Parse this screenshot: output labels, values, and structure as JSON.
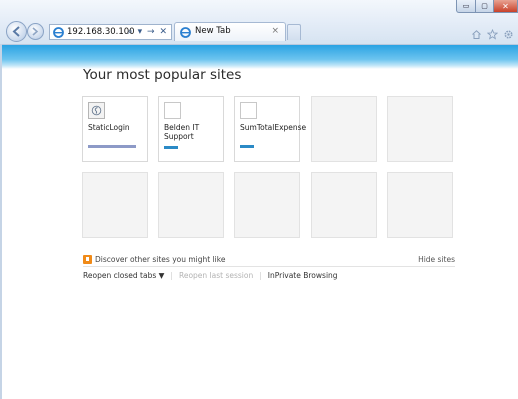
{
  "browser": {
    "address": {
      "url": "192.168.30.100",
      "tools": "⌕ ▾ → ✕"
    },
    "tab": {
      "label": "New Tab",
      "close": "×"
    },
    "window": {
      "minimize": "▭",
      "maximize": "▢",
      "close": "✕"
    }
  },
  "page": {
    "title": "Your most popular sites",
    "tiles": [
      {
        "name": "StaticLogin",
        "bar_fraction": 0.85
      },
      {
        "name": "Belden IT Support",
        "bar_fraction": 0.25
      },
      {
        "name": "SumTotalExpense",
        "bar_fraction": 0.25
      },
      {
        "name": ""
      },
      {
        "name": ""
      },
      {
        "name": ""
      },
      {
        "name": ""
      },
      {
        "name": ""
      },
      {
        "name": ""
      },
      {
        "name": ""
      }
    ],
    "discover_text": "Discover other sites you might like",
    "hide_sites": "Hide sites",
    "reopen_closed_tabs": "Reopen closed tabs ▼",
    "reopen_last_session": "Reopen last session",
    "inprivate": "InPrivate Browsing",
    "colors": {
      "accent": "#2b8ac6",
      "banner": "#2aa3e3",
      "discover_icon": "#f08a18"
    }
  }
}
